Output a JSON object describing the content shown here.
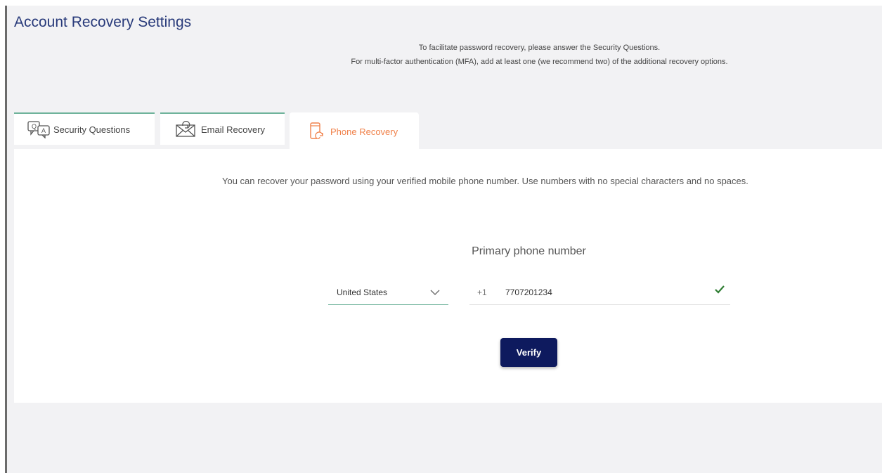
{
  "header": {
    "title": "Account Recovery Settings",
    "intro_line1": "To facilitate password recovery, please answer the Security Questions.",
    "intro_line2": "For multi-factor authentication (MFA), add at least one (we recommend two) of the additional recovery options."
  },
  "tabs": [
    {
      "label": "Security Questions",
      "icon": "security-questions-icon",
      "active": false
    },
    {
      "label": "Email Recovery",
      "icon": "email-icon",
      "active": false
    },
    {
      "label": "Phone Recovery",
      "icon": "phone-icon",
      "active": true
    }
  ],
  "panel": {
    "description": "You can recover your password using your verified mobile phone number. Use numbers with no special characters and no spaces.",
    "field_heading": "Primary phone number",
    "country": {
      "selected": "United States"
    },
    "phone": {
      "country_code": "+1",
      "value": "7707201234",
      "verified": true
    },
    "verify_label": "Verify"
  },
  "colors": {
    "title": "#283a7a",
    "active_tab": "#f0814a",
    "tab_accent": "#6fb39b",
    "button": "#0e1a5e",
    "check": "#2e7d32"
  }
}
